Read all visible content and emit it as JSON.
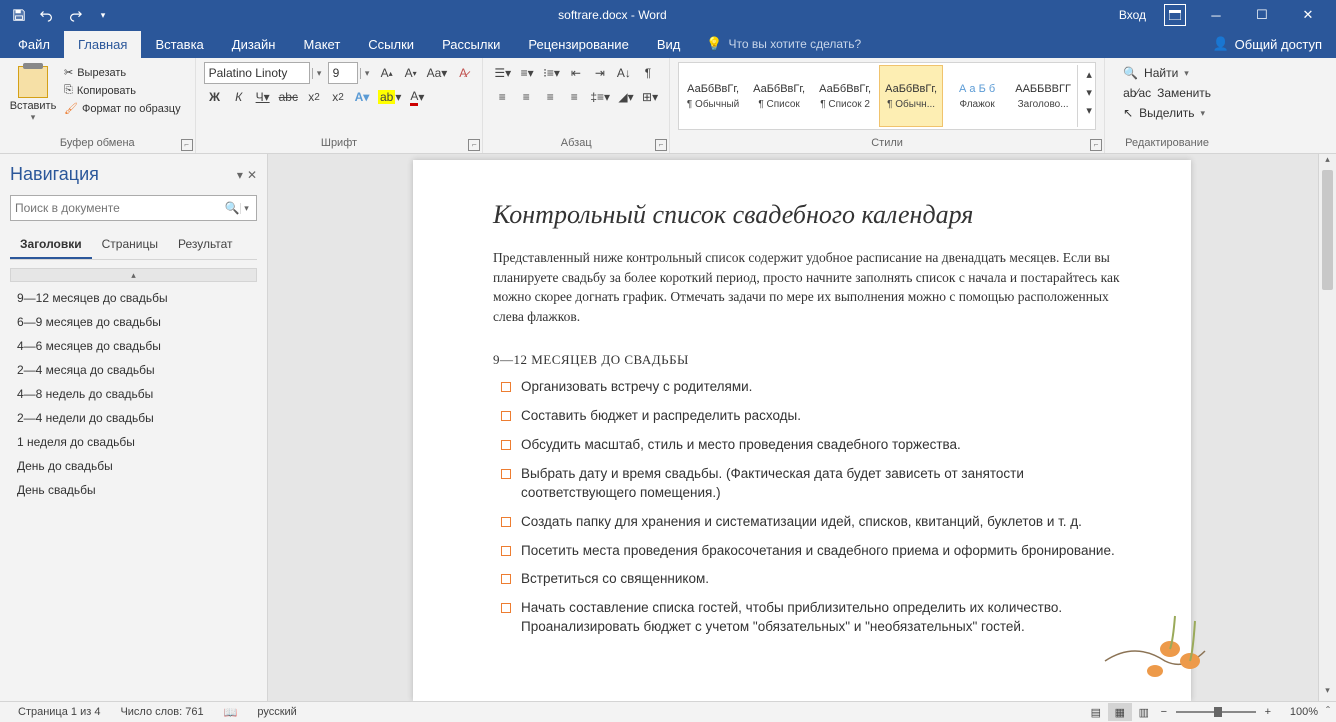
{
  "titlebar": {
    "title": "softrare.docx - Word",
    "signin": "Вход"
  },
  "tabs": {
    "file": "Файл",
    "home": "Главная",
    "insert": "Вставка",
    "design": "Дизайн",
    "layout": "Макет",
    "references": "Ссылки",
    "mailings": "Рассылки",
    "review": "Рецензирование",
    "view": "Вид",
    "tellme": "Что вы хотите сделать?",
    "share": "Общий доступ"
  },
  "ribbon": {
    "clipboard": {
      "paste": "Вставить",
      "cut": "Вырезать",
      "copy": "Копировать",
      "format_painter": "Формат по образцу",
      "group": "Буфер обмена"
    },
    "font": {
      "name": "Palatino Linoty",
      "size": "9",
      "group": "Шрифт"
    },
    "paragraph": {
      "group": "Абзац"
    },
    "styles": {
      "group": "Стили",
      "items": [
        {
          "preview": "АаБбВвГг,",
          "label": "¶ Обычный"
        },
        {
          "preview": "АаБбВвГг,",
          "label": "¶ Список"
        },
        {
          "preview": "АаБбВвГг,",
          "label": "¶ Список 2"
        },
        {
          "preview": "АаБбВвГг,",
          "label": "¶ Обычн..."
        },
        {
          "preview": "А а Б б",
          "label": "Флажок"
        },
        {
          "preview": "ААББВВГГ",
          "label": "Заголово..."
        }
      ]
    },
    "editing": {
      "find": "Найти",
      "replace": "Заменить",
      "select": "Выделить",
      "group": "Редактирование"
    }
  },
  "navigation": {
    "title": "Навигация",
    "search_placeholder": "Поиск в документе",
    "tabs": {
      "headings": "Заголовки",
      "pages": "Страницы",
      "results": "Результат"
    },
    "items": [
      "9—12 месяцев до свадьбы",
      "6—9 месяцев до свадьбы",
      "4—6 месяцев до свадьбы",
      "2—4 месяца до свадьбы",
      "4—8 недель до свадьбы",
      "2—4 недели до свадьбы",
      "1 неделя до свадьбы",
      "День до свадьбы",
      "День свадьбы"
    ]
  },
  "document": {
    "title": "Контрольный список свадебного календаря",
    "intro": "Представленный ниже контрольный список содержит удобное расписание на двенадцать месяцев. Если вы планируете свадьбу за более короткий период, просто начните заполнять список с начала и постарайтесь как можно скорее догнать график. Отмечать задачи по мере их выполнения можно с помощью расположенных слева флажков.",
    "section1": "9—12 МЕСЯЦЕВ ДО СВАДЬБЫ",
    "checklist": [
      "Организовать встречу с родителями.",
      "Составить бюджет и распределить расходы.",
      "Обсудить масштаб, стиль и место проведения свадебного торжества.",
      "Выбрать дату и время свадьбы. (Фактическая дата будет зависеть от занятости соответствующего помещения.)",
      "Создать папку для хранения и систематизации идей, списков, квитанций, буклетов и т. д.",
      "Посетить места проведения бракосочетания и свадебного приема и оформить бронирование.",
      "Встретиться со священником.",
      "Начать составление списка гостей, чтобы приблизительно определить их количество. Проанализировать бюджет с учетом \"обязательных\" и \"необязательных\" гостей."
    ]
  },
  "status": {
    "page": "Страница 1 из 4",
    "words": "Число слов: 761",
    "language": "русский",
    "zoom": "100%"
  }
}
